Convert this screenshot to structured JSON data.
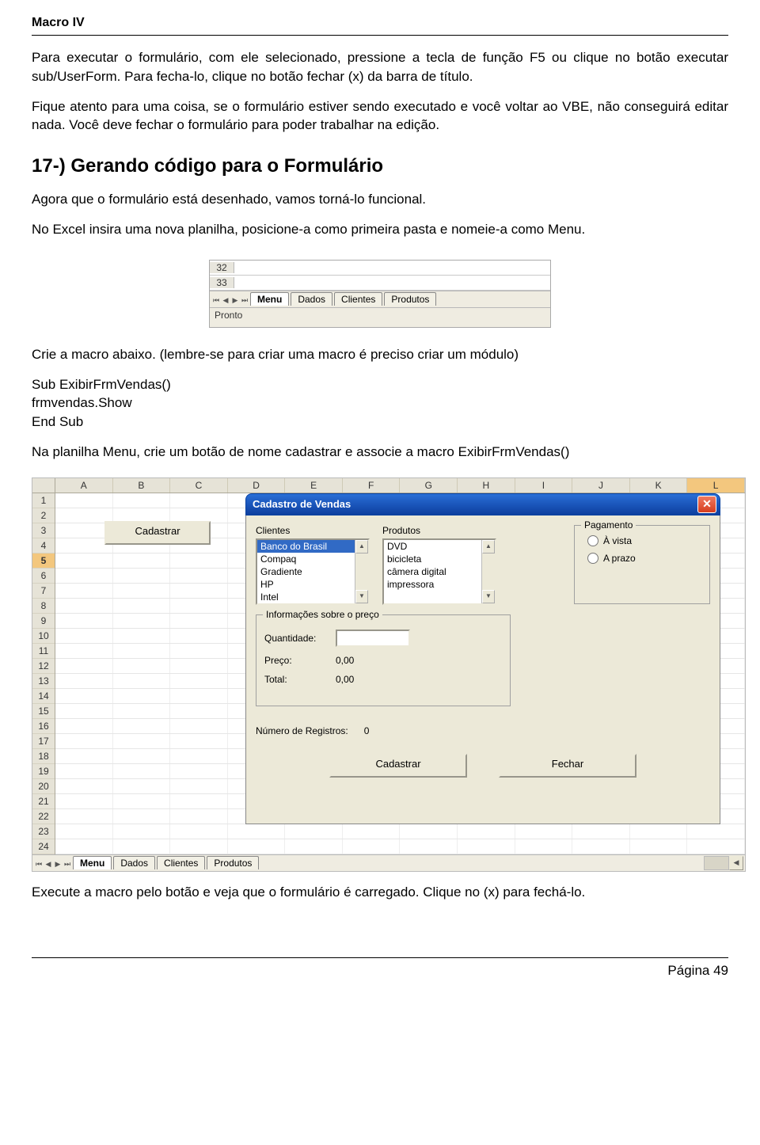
{
  "header": "Macro IV",
  "para1": "Para executar o formulário, com ele selecionado, pressione a tecla de função F5 ou clique no botão executar sub/UserForm. Para fecha-lo, clique no botão fechar (x) da barra de título.",
  "para2": "Fique atento para uma coisa, se o formulário estiver sendo executado e você voltar ao VBE, não conseguirá editar nada. Você deve fechar o formulário para poder trabalhar na edição.",
  "section_title": "17-) Gerando código para o Formulário",
  "para3": "Agora que o formulário está desenhado, vamos torná-lo funcional.",
  "para4": "No Excel insira uma nova planilha, posicione-a como primeira pasta e nomeie-a como Menu.",
  "snip1": {
    "rows": [
      "32",
      "33"
    ],
    "tabs": [
      "Menu",
      "Dados",
      "Clientes",
      "Produtos"
    ],
    "status": "Pronto"
  },
  "para5": "Crie a macro abaixo. (lembre-se para criar uma macro é preciso criar um módulo)",
  "code": "Sub ExibirFrmVendas()\nfrmvendas.Show\nEnd Sub",
  "para6": "Na planilha Menu, crie um botão de nome cadastrar e associe a macro ExibirFrmVendas()",
  "excel": {
    "cols": [
      "A",
      "B",
      "C",
      "D",
      "E",
      "F",
      "G",
      "H",
      "I",
      "J",
      "K",
      "L"
    ],
    "rows": [
      "1",
      "2",
      "3",
      "4",
      "5",
      "6",
      "7",
      "8",
      "9",
      "10",
      "11",
      "12",
      "13",
      "14",
      "15",
      "16",
      "17",
      "18",
      "19",
      "20",
      "21",
      "22",
      "23",
      "24"
    ],
    "selected_row": "5",
    "selected_col": "L",
    "cadastrar_btn": "Cadastrar",
    "tabs": [
      "Menu",
      "Dados",
      "Clientes",
      "Produtos"
    ]
  },
  "dialog": {
    "title": "Cadastro de Vendas",
    "clientes_label": "Clientes",
    "clientes_items": [
      "Banco do Brasil",
      "Compaq",
      "Gradiente",
      "HP",
      "Intel"
    ],
    "produtos_label": "Produtos",
    "produtos_items": [
      "DVD",
      "bicicleta",
      "câmera digital",
      "impressora"
    ],
    "pagamento_legend": "Pagamento",
    "radio_avista": "À vista",
    "radio_aprazo": "A prazo",
    "info_legend": "Informações sobre o preço",
    "quantidade_label": "Quantidade:",
    "preco_label": "Preço:",
    "preco_val": "0,00",
    "total_label": "Total:",
    "total_val": "0,00",
    "numreg_label": "Número de Registros:",
    "numreg_val": "0",
    "btn_cadastrar": "Cadastrar",
    "btn_fechar": "Fechar"
  },
  "para7": "Execute a macro pelo botão e veja que o formulário é carregado. Clique no (x) para fechá-lo.",
  "footer": "Página 49"
}
